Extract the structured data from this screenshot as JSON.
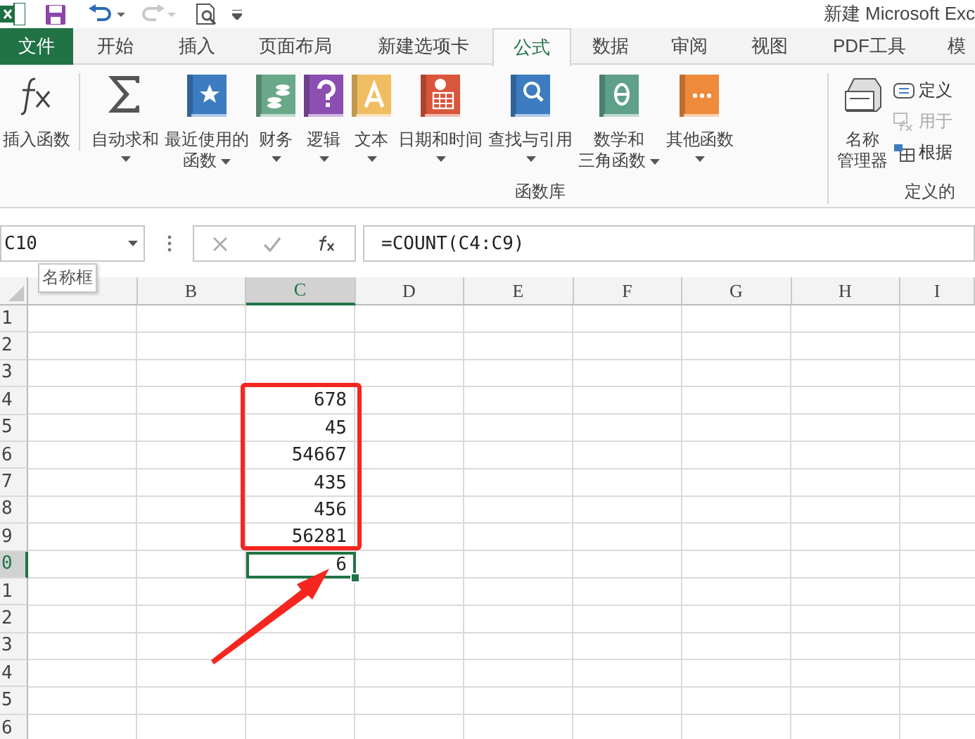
{
  "window": {
    "title": "新建 Microsoft Exc"
  },
  "quick_access": {
    "redo": {
      "disabled": true
    }
  },
  "tabs": [
    {
      "label": "文件",
      "kind": "file",
      "selected": false
    },
    {
      "label": "开始",
      "kind": "tab",
      "selected": false
    },
    {
      "label": "插入",
      "kind": "tab",
      "selected": false
    },
    {
      "label": "页面布局",
      "kind": "tab",
      "selected": false
    },
    {
      "label": "新建选项卡",
      "kind": "tab",
      "selected": false
    },
    {
      "label": "公式",
      "kind": "tab",
      "selected": true
    },
    {
      "label": "数据",
      "kind": "tab",
      "selected": false
    },
    {
      "label": "审阅",
      "kind": "tab",
      "selected": false
    },
    {
      "label": "视图",
      "kind": "tab",
      "selected": false
    },
    {
      "label": "PDF工具",
      "kind": "tab",
      "selected": false
    },
    {
      "label": "模",
      "kind": "tab",
      "selected": false
    }
  ],
  "ribbon": {
    "groups": [
      {
        "label": "函数库",
        "buttons": [
          {
            "lines": [
              "插入函数"
            ],
            "kind": "fx",
            "dropdown": false
          },
          {
            "lines": [
              "自动求和"
            ],
            "kind": "sum",
            "dropdown": true
          },
          {
            "lines": [
              "最近使用的",
              "函数"
            ],
            "kind": "star",
            "dropdown": true
          },
          {
            "lines": [
              "财务"
            ],
            "kind": "coins",
            "dropdown": true
          },
          {
            "lines": [
              "逻辑"
            ],
            "kind": "logic",
            "dropdown": true
          },
          {
            "lines": [
              "文本"
            ],
            "kind": "text",
            "dropdown": true
          },
          {
            "lines": [
              "日期和时间"
            ],
            "kind": "calendar",
            "dropdown": true
          },
          {
            "lines": [
              "查找与引用"
            ],
            "kind": "lookup",
            "dropdown": true
          },
          {
            "lines": [
              "数学和",
              "三角函数"
            ],
            "kind": "math",
            "dropdown": true
          },
          {
            "lines": [
              "其他函数"
            ],
            "kind": "more",
            "dropdown": true
          }
        ]
      },
      {
        "label": "定义的",
        "buttons": [
          {
            "lines": [
              "名称",
              "管理器"
            ],
            "kind": "names",
            "dropdown": false
          }
        ],
        "small_items": [
          {
            "label": "定义",
            "kind": "define",
            "disabled": false
          },
          {
            "label": "用于",
            "kind": "use",
            "disabled": true
          },
          {
            "label": "根据",
            "kind": "create",
            "disabled": false
          }
        ]
      }
    ]
  },
  "formula_bar": {
    "name_box": "C10",
    "formula": "=COUNT(C4:C9)"
  },
  "tooltip": "名称框",
  "sheet": {
    "columns": [
      {
        "selected": false
      },
      {
        "label": "B",
        "selected": false
      },
      {
        "label": "C",
        "selected": true
      },
      {
        "label": "D",
        "selected": false
      },
      {
        "label": "E",
        "selected": false
      },
      {
        "label": "F",
        "selected": false
      },
      {
        "label": "G",
        "selected": false
      },
      {
        "label": "H",
        "selected": false
      },
      {
        "label": "I",
        "selected": false
      }
    ],
    "rows": [
      {
        "label": "1",
        "selected": false
      },
      {
        "label": "2",
        "selected": false
      },
      {
        "label": "3",
        "selected": false
      },
      {
        "label": "4",
        "selected": false,
        "c": "678"
      },
      {
        "label": "5",
        "selected": false,
        "c": "45"
      },
      {
        "label": "6",
        "selected": false,
        "c": "54667"
      },
      {
        "label": "7",
        "selected": false,
        "c": "435"
      },
      {
        "label": "8",
        "selected": false,
        "c": "456"
      },
      {
        "label": "9",
        "selected": false,
        "c": "56281"
      },
      {
        "label": "0",
        "selected": true,
        "c": "6"
      },
      {
        "label": "1",
        "selected": false
      },
      {
        "label": "2",
        "selected": false
      },
      {
        "label": "3",
        "selected": false
      },
      {
        "label": "4",
        "selected": false
      },
      {
        "label": "5",
        "selected": false
      },
      {
        "label": "6",
        "selected": false
      }
    ]
  }
}
